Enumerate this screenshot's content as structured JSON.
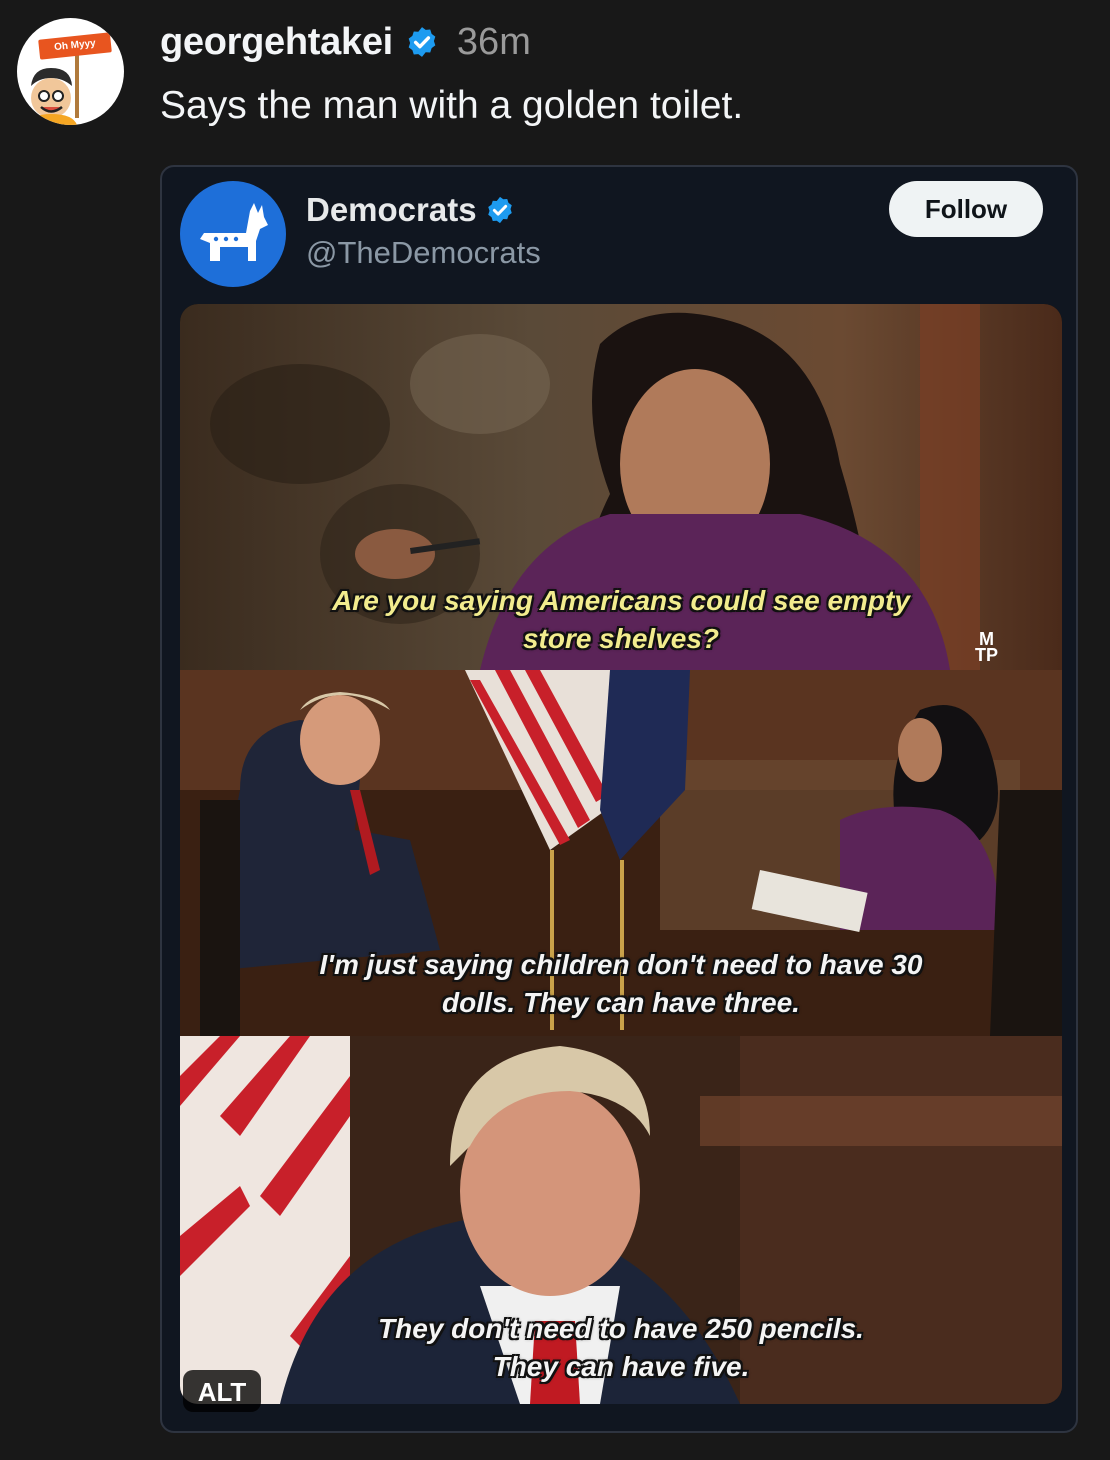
{
  "post": {
    "avatar_sign_text": "Oh Myyy",
    "username": "georgehtakei",
    "timestamp": "36m",
    "text": "Says the man with a golden toilet."
  },
  "embed": {
    "name": "Democrats",
    "handle": "@TheDemocrats",
    "follow_label": "Follow",
    "panels": [
      {
        "subtitle_line1": "Are you saying Americans could see empty",
        "subtitle_line2": "store shelves?"
      },
      {
        "subtitle_line1": "I'm just saying children don't need to have 30",
        "subtitle_line2": "dolls. They can have three."
      },
      {
        "subtitle_line1": "They don't need to have 250 pencils.",
        "subtitle_line2": "They can have five."
      }
    ],
    "watermark_top": "M",
    "watermark_bottom": "TP",
    "alt_label": "ALT"
  },
  "colors": {
    "background": "#181818",
    "card_bg": "#101620",
    "verified_blue": "#1d9bf0",
    "democrats_blue": "#1e6fd9",
    "subtitle_yellow": "#f2ec8e"
  }
}
